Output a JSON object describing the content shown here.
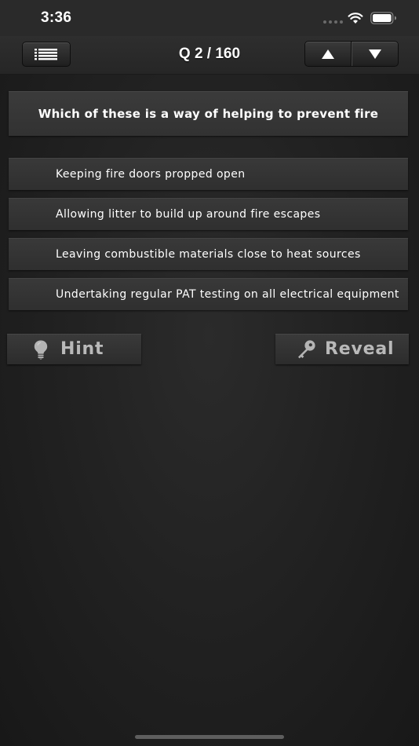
{
  "status_bar": {
    "time": "3:36",
    "icons": [
      "signal-dots-icon",
      "wifi-icon",
      "battery-icon"
    ]
  },
  "nav": {
    "menu_icon": "list-icon",
    "title": "Q 2 / 160",
    "up_icon": "triangle-up-icon",
    "down_icon": "triangle-down-icon"
  },
  "question": {
    "text": "Which of these is a way of helping to prevent fire"
  },
  "answers": [
    {
      "label": "Keeping fire doors propped open"
    },
    {
      "label": "Allowing litter to build up around fire escapes"
    },
    {
      "label": "Leaving combustible materials close to heat sources"
    },
    {
      "label": "Undertaking regular PAT testing on all electrical equipment"
    }
  ],
  "actions": {
    "hint": {
      "label": "Hint",
      "icon": "lightbulb-icon"
    },
    "reveal": {
      "label": "Reveal",
      "icon": "key-icon"
    }
  },
  "colors": {
    "background": "#222222",
    "panel": "#363636",
    "text": "#ffffff",
    "muted_text": "#b9b9b9"
  }
}
